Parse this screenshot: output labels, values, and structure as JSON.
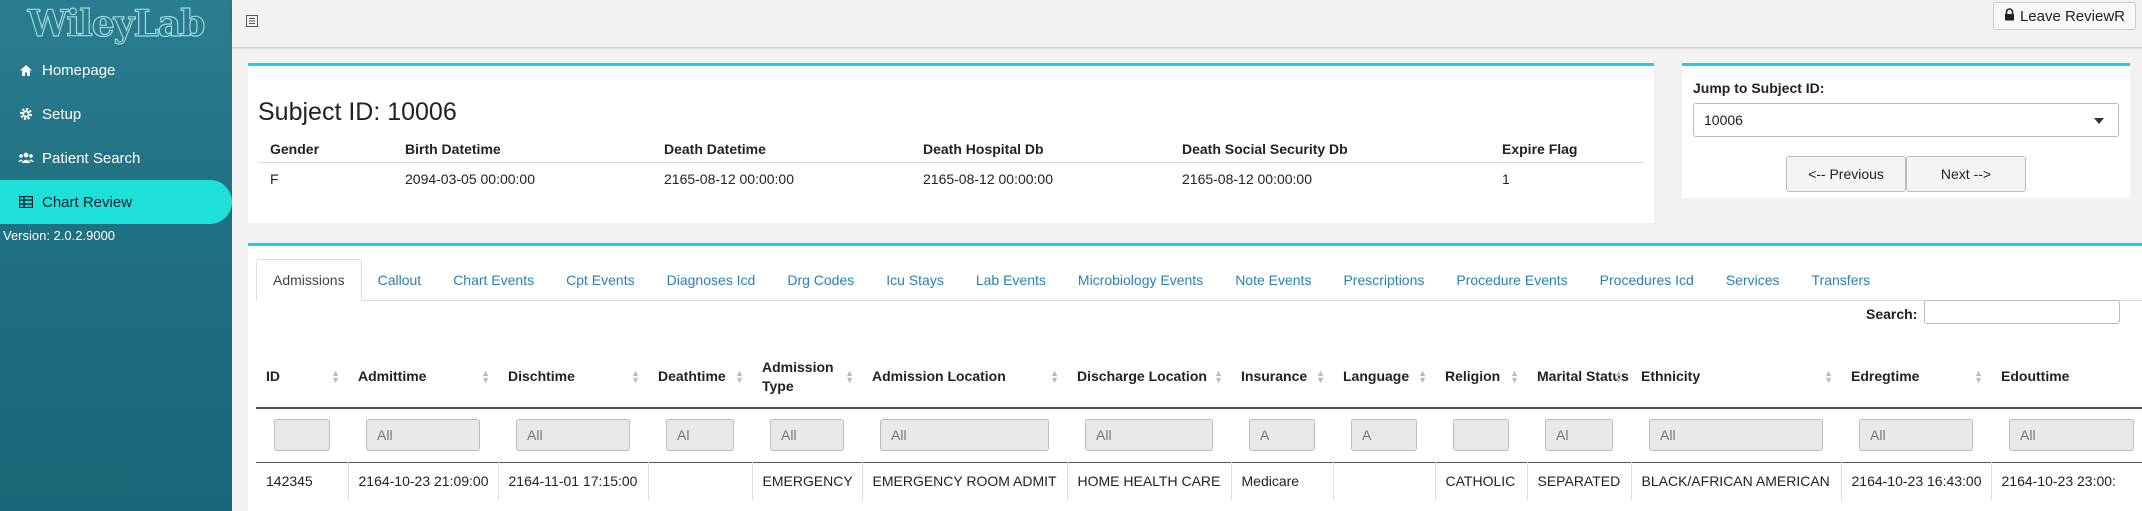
{
  "sidebar": {
    "logo": "WileyLab",
    "items": [
      {
        "label": "Homepage",
        "icon": "home-icon"
      },
      {
        "label": "Setup",
        "icon": "gear-icon"
      },
      {
        "label": "Patient Search",
        "icon": "users-icon"
      },
      {
        "label": "Chart Review",
        "icon": "table-icon"
      }
    ],
    "version": "Version: 2.0.2.9000"
  },
  "topbar": {
    "leave_label": "Leave ReviewR"
  },
  "subject": {
    "title": "Subject ID: 10006",
    "headers": [
      "Gender",
      "Birth Datetime",
      "Death Datetime",
      "Death Hospital Db",
      "Death Social Security Db",
      "Expire Flag"
    ],
    "values": [
      "F",
      "2094-03-05 00:00:00",
      "2165-08-12 00:00:00",
      "2165-08-12 00:00:00",
      "2165-08-12 00:00:00",
      "1"
    ]
  },
  "jump": {
    "label": "Jump to Subject ID:",
    "selected": "10006",
    "prev_label": "<-- Previous",
    "next_label": "Next -->"
  },
  "tabs": [
    "Admissions",
    "Callout",
    "Chart Events",
    "Cpt Events",
    "Diagnoses Icd",
    "Drg Codes",
    "Icu Stays",
    "Lab Events",
    "Microbiology Events",
    "Note Events",
    "Prescriptions",
    "Procedure Events",
    "Procedures Icd",
    "Services",
    "Transfers"
  ],
  "search_label": "Search:",
  "table": {
    "headers": [
      "ID",
      "Admittime",
      "Dischtime",
      "Deathtime",
      "Admission Type",
      "Admission Location",
      "Discharge Location",
      "Insurance",
      "Language",
      "Religion",
      "Marital Status",
      "Ethnicity",
      "Edregtime",
      "Edouttime"
    ],
    "filters": [
      "",
      "All",
      "All",
      "Al",
      "All",
      "All",
      "All",
      "A",
      "A",
      "",
      "Al",
      "All",
      "All",
      "All"
    ],
    "rows": [
      [
        "142345",
        "2164-10-23 21:09:00",
        "2164-11-01 17:15:00",
        "",
        "EMERGENCY",
        "EMERGENCY ROOM ADMIT",
        "HOME HEALTH CARE",
        "Medicare",
        "",
        "CATHOLIC",
        "SEPARATED",
        "BLACK/AFRICAN AMERICAN",
        "2164-10-23 16:43:00",
        "2164-10-23 23:00:"
      ]
    ]
  }
}
